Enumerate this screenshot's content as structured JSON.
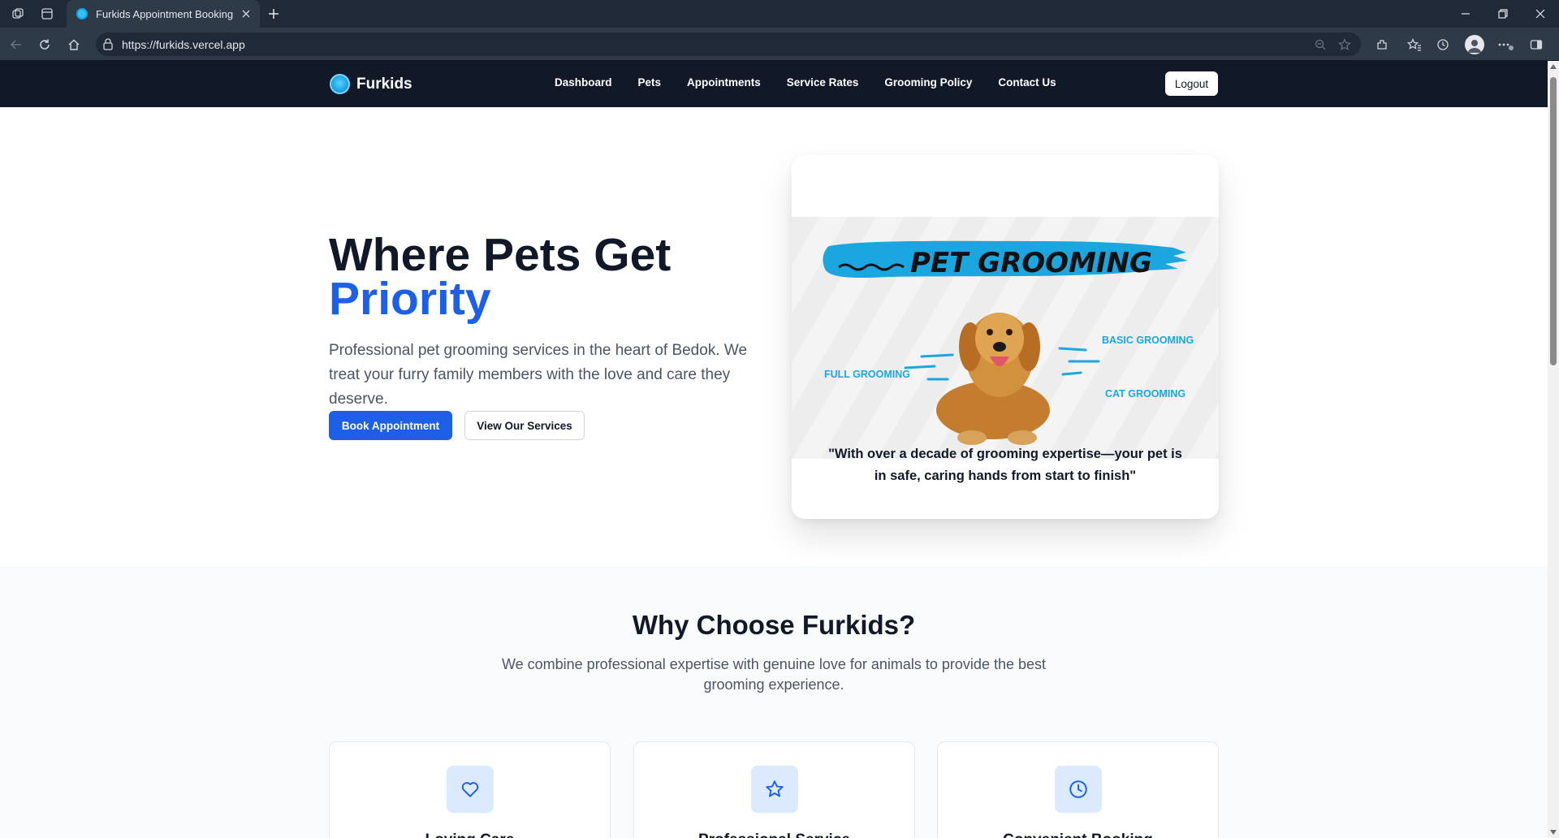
{
  "browser": {
    "tab_title": "Furkids Appointment Booking",
    "url": "https://furkids.vercel.app"
  },
  "site": {
    "brand_name": "Furkids",
    "nav_links": [
      "Dashboard",
      "Pets",
      "Appointments",
      "Service Rates",
      "Grooming Policy",
      "Contact Us"
    ],
    "logout_label": "Logout"
  },
  "hero": {
    "title_line1": "Where Pets Get",
    "title_line2": "Priority",
    "subtitle": "Professional pet grooming services in the heart of Bedok. We treat your furry family members with the love and care they deserve.",
    "primary_button": "Book Appointment",
    "secondary_button": "View Our Services"
  },
  "promo": {
    "banner_text": "PET GROOMING",
    "label_full": "FULL GROOMING",
    "label_basic": "BASIC GROOMING",
    "label_cat": "CAT GROOMING",
    "quote": "\"With over a decade of grooming expertise—your pet is in safe, caring hands from start to finish\""
  },
  "why": {
    "title": "Why Choose Furkids?",
    "subtitle": "We combine professional expertise with genuine love for animals to provide the best grooming experience.",
    "features": [
      {
        "icon": "heart-icon",
        "title": "Loving Care"
      },
      {
        "icon": "star-icon",
        "title": "Professional Service"
      },
      {
        "icon": "clock-icon",
        "title": "Convenient Booking"
      }
    ]
  },
  "colors": {
    "navbar_bg": "#111827",
    "accent_blue": "#1d5fe6",
    "promo_cyan": "#1ba6e0",
    "feature_icon_bg": "#dbeafe"
  }
}
